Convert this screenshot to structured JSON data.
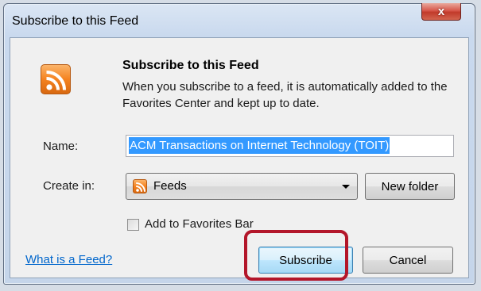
{
  "window": {
    "title": "Subscribe to this Feed",
    "close_glyph": "x"
  },
  "dialog": {
    "heading": "Subscribe to this Feed",
    "description": "When you subscribe to a feed, it is automatically added to the Favorites Center and kept up to date.",
    "feed_icon": "rss-icon"
  },
  "form": {
    "name_label": "Name:",
    "name_value": "ACM Transactions on Internet Technology (TOIT)",
    "create_in_label": "Create in:",
    "create_in_value": "Feeds",
    "new_folder_label": "New folder",
    "favorites_bar_label": "Add to Favorites Bar",
    "favorites_bar_checked": false
  },
  "footer": {
    "help_link": "What is a Feed?",
    "subscribe_label": "Subscribe",
    "cancel_label": "Cancel"
  },
  "colors": {
    "highlight": "#b3162a",
    "selection": "#3399ff",
    "link": "#0066cc",
    "rss_orange": "#f58320"
  }
}
